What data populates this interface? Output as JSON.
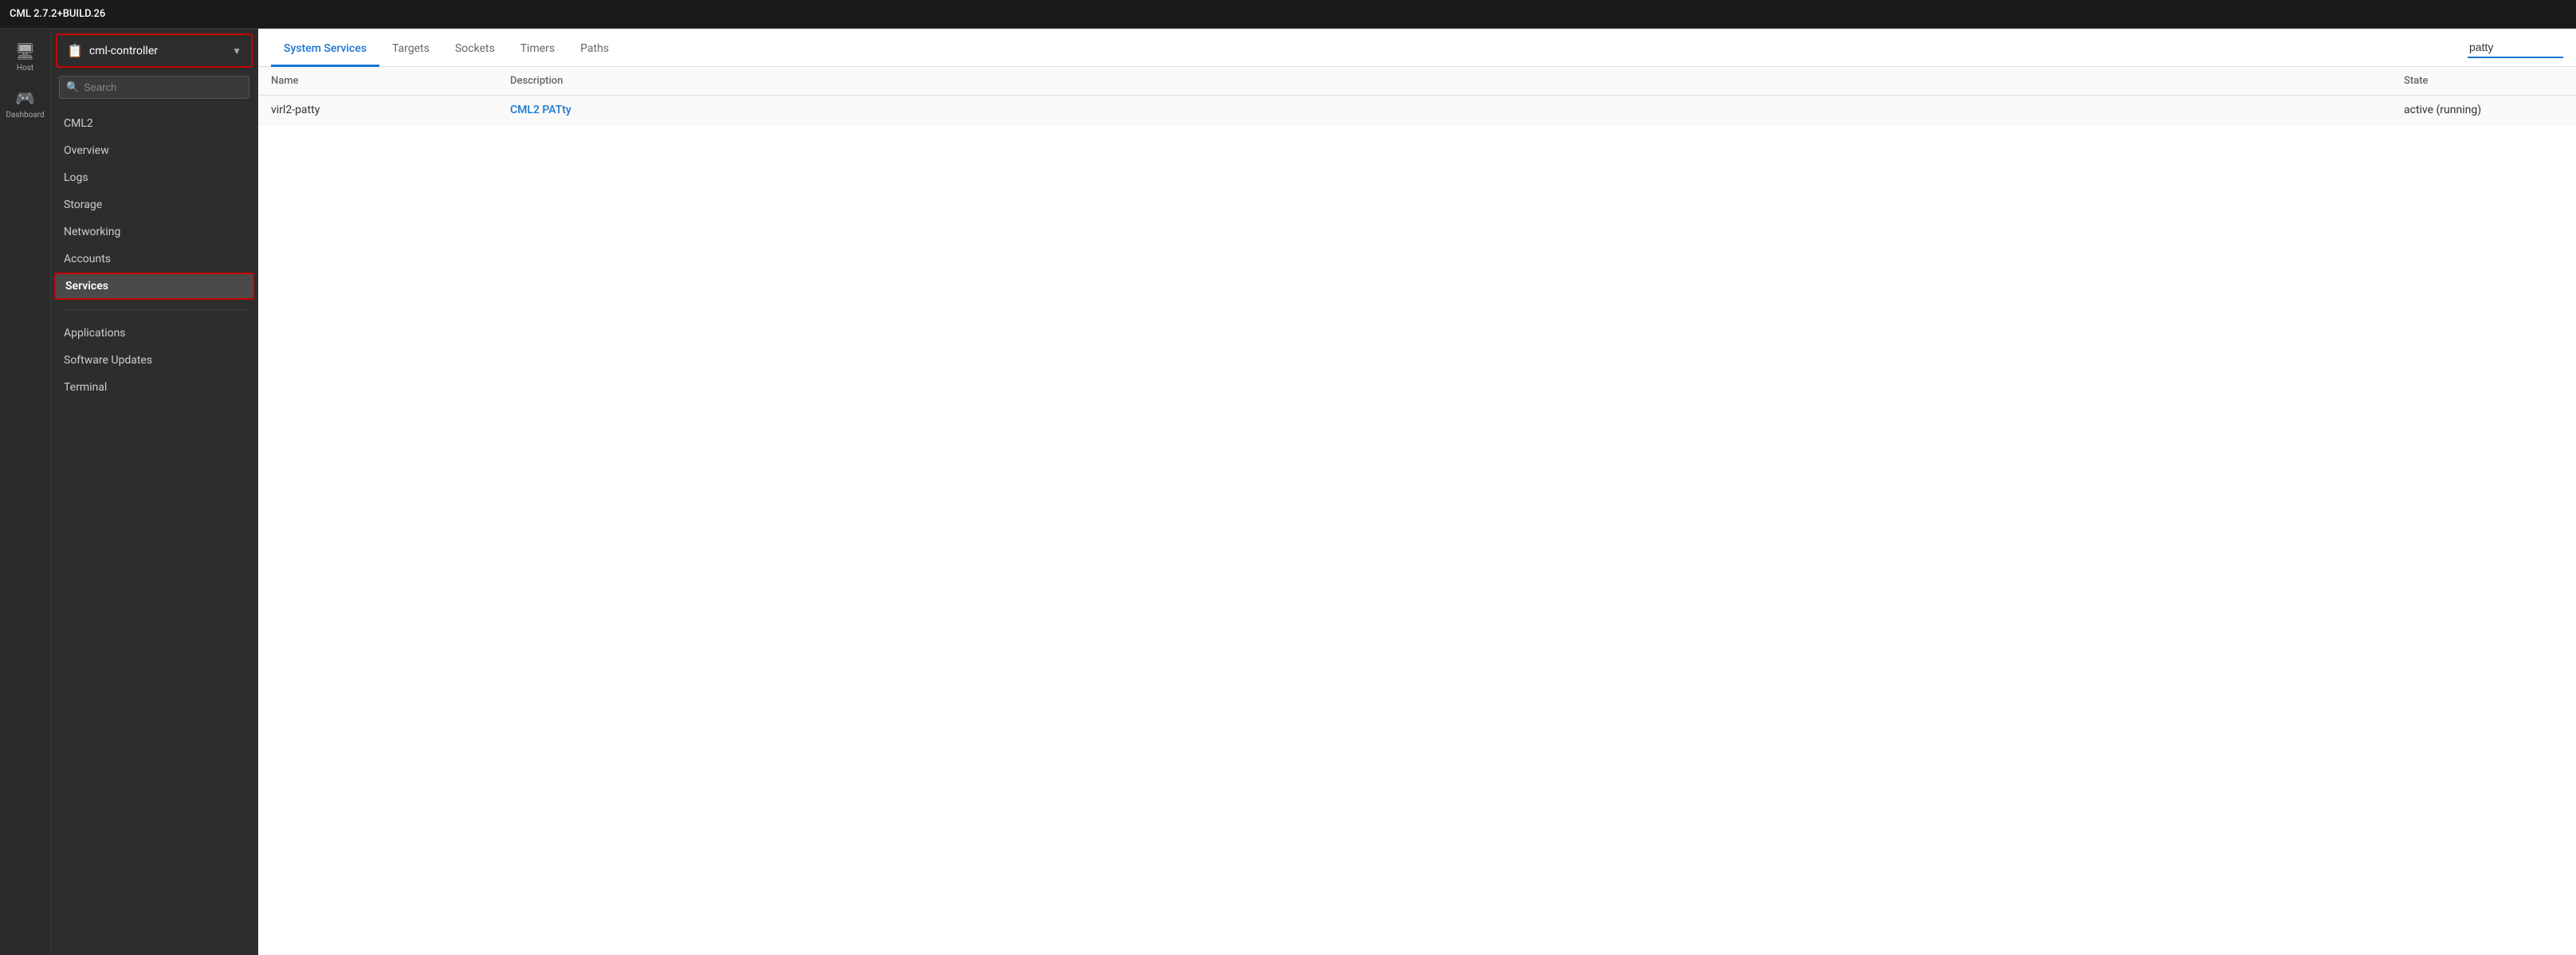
{
  "app": {
    "title": "CML 2.7.2+BUILD.26"
  },
  "icon_nav": [
    {
      "id": "host",
      "icon": "🖥",
      "label": "Host"
    },
    {
      "id": "dashboard",
      "icon": "🎮",
      "label": "Dashboard"
    }
  ],
  "sidebar": {
    "controller_label": "cml-controller",
    "controller_icon": "📋",
    "search_placeholder": "Search",
    "nav_items": [
      {
        "id": "cml2",
        "label": "CML2",
        "active": false
      },
      {
        "id": "overview",
        "label": "Overview",
        "active": false
      },
      {
        "id": "logs",
        "label": "Logs",
        "active": false
      },
      {
        "id": "storage",
        "label": "Storage",
        "active": false
      },
      {
        "id": "networking",
        "label": "Networking",
        "active": false
      },
      {
        "id": "accounts",
        "label": "Accounts",
        "active": false
      },
      {
        "id": "services",
        "label": "Services",
        "active": true
      }
    ],
    "secondary_items": [
      {
        "id": "applications",
        "label": "Applications"
      },
      {
        "id": "software-updates",
        "label": "Software Updates"
      },
      {
        "id": "terminal",
        "label": "Terminal"
      }
    ]
  },
  "tabs": [
    {
      "id": "system-services",
      "label": "System Services",
      "active": true
    },
    {
      "id": "targets",
      "label": "Targets",
      "active": false
    },
    {
      "id": "sockets",
      "label": "Sockets",
      "active": false
    },
    {
      "id": "timers",
      "label": "Timers",
      "active": false
    },
    {
      "id": "paths",
      "label": "Paths",
      "active": false
    }
  ],
  "search_value": "patty",
  "table": {
    "columns": [
      "Name",
      "Description",
      "State"
    ],
    "rows": [
      {
        "name": "virl2-patty",
        "description": "CML2 PATty",
        "state": "active (running)"
      }
    ]
  }
}
